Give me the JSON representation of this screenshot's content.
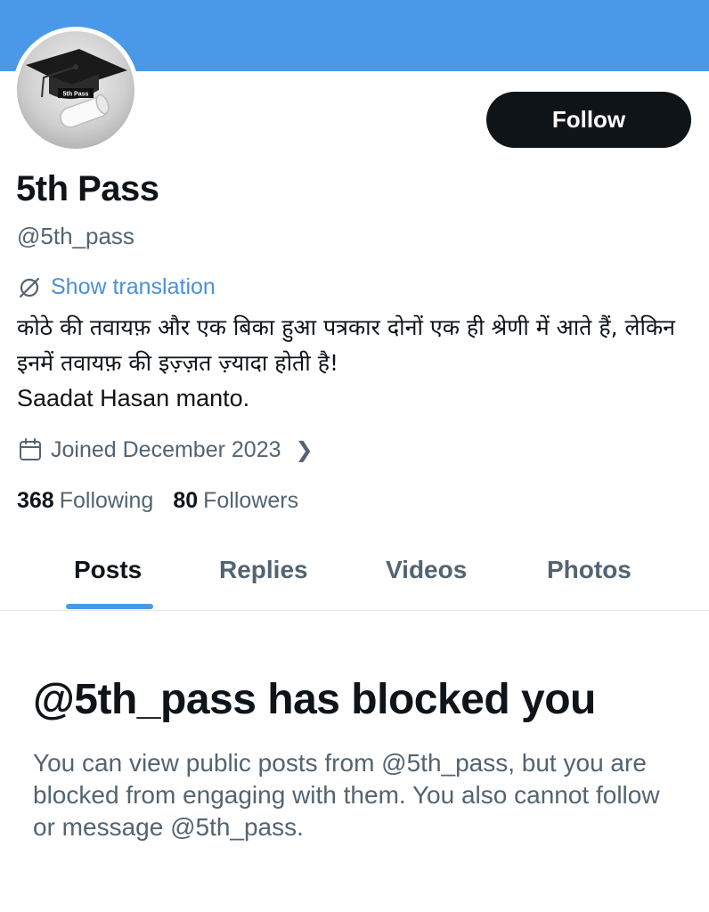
{
  "profile": {
    "name": "5th Pass",
    "handle": "@5th_pass",
    "avatar_text": "5th Pass",
    "show_translation": "Show translation",
    "bio_hindi": "कोठे की तवायफ़ और एक बिका हुआ पत्रकार दोनों एक ही श्रेणी में आते हैं, लेकिन इनमें तवायफ़ की इज़्ज़त ज़्यादा होती है!",
    "bio_author": "Saadat Hasan manto.",
    "joined": "Joined December 2023",
    "following_count": "368",
    "following_label": "Following",
    "followers_count": "80",
    "followers_label": "Followers"
  },
  "follow_button": "Follow",
  "tabs": [
    {
      "label": "Posts",
      "active": true
    },
    {
      "label": "Replies",
      "active": false
    },
    {
      "label": "Videos",
      "active": false
    },
    {
      "label": "Photos",
      "active": false
    }
  ],
  "blocked": {
    "title": "@5th_pass has blocked you",
    "message": "You can view public posts from @5th_pass, but you are blocked from engaging with them. You also cannot follow or message @5th_pass."
  },
  "colors": {
    "banner": "#4a99e9",
    "accent": "#4a90d9",
    "text_primary": "#0f1419",
    "text_secondary": "#536471"
  },
  "icons": {
    "translation": "translate-icon",
    "calendar": "calendar-icon",
    "chevron": "chevron-right-icon"
  }
}
